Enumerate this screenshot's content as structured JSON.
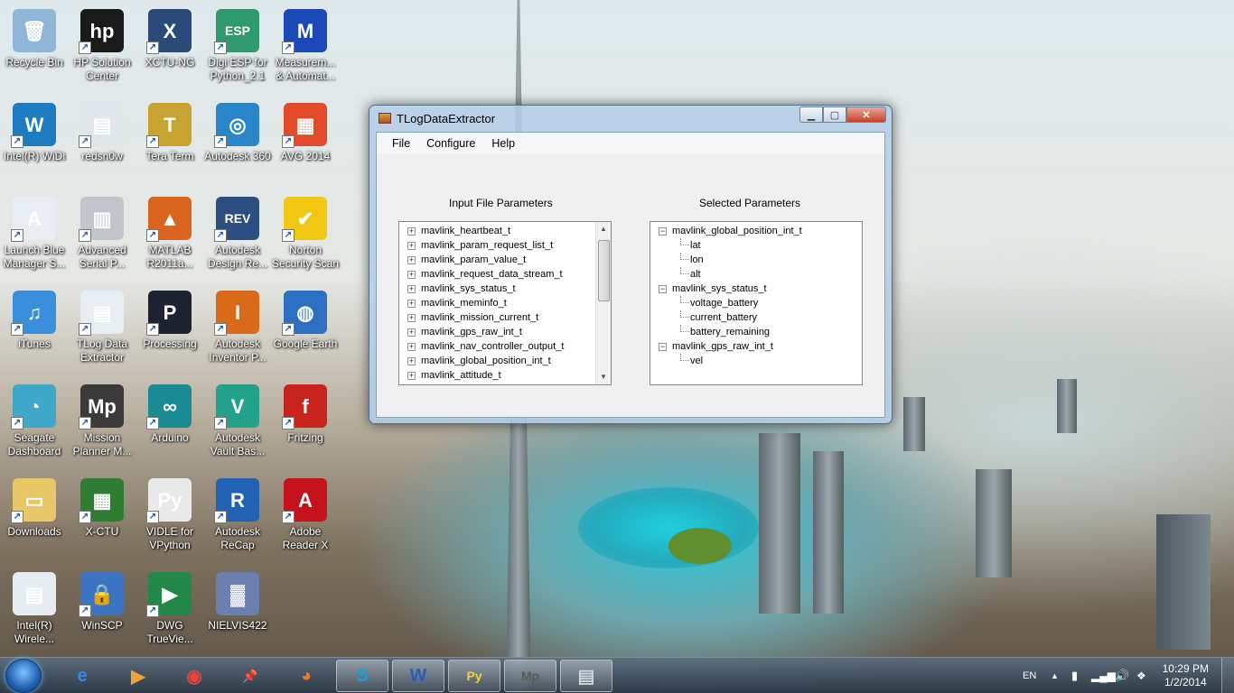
{
  "desktop": {
    "icons": [
      {
        "label": "Recycle Bin",
        "icon": "recycle-bin-icon",
        "color": "#8fb6d6",
        "glyph": "🗑",
        "shortcut": false
      },
      {
        "label": "HP Solution Center",
        "icon": "hp-icon",
        "color": "#1a1a1a",
        "glyph": "hp",
        "shortcut": true
      },
      {
        "label": "XCTU-NG",
        "icon": "xctu-icon",
        "color": "#2a4b7a",
        "glyph": "X",
        "shortcut": true
      },
      {
        "label": "Digi ESP for Python_2.1",
        "icon": "esp-icon",
        "color": "#2e9a6e",
        "glyph": "ESP",
        "shortcut": true
      },
      {
        "label": "Measurem... & Automat...",
        "icon": "measurement-icon",
        "color": "#1b49b8",
        "glyph": "M",
        "shortcut": true
      },
      {
        "label": "Intel(R) WiDi",
        "icon": "widi-icon",
        "color": "#1d7bc1",
        "glyph": "W",
        "shortcut": true
      },
      {
        "label": "redsn0w",
        "icon": "redsn0w-icon",
        "color": "#dfe7ec",
        "glyph": "▤",
        "shortcut": true
      },
      {
        "label": "Tera Term",
        "icon": "teraterm-icon",
        "color": "#c7a431",
        "glyph": "T",
        "shortcut": true
      },
      {
        "label": "Autodesk 360",
        "icon": "autodesk360-icon",
        "color": "#2a86c8",
        "glyph": "◎",
        "shortcut": true
      },
      {
        "label": "AVG 2014",
        "icon": "avg-icon",
        "color": "#e14b2a",
        "glyph": "▦",
        "shortcut": true
      },
      {
        "label": "Launch Blue Manager S...",
        "icon": "bluetooth-icon",
        "color": "#e9eef4",
        "glyph": "A",
        "shortcut": true
      },
      {
        "label": "Advanced Serial P...",
        "icon": "serial-port-icon",
        "color": "#c0c6cc",
        "glyph": "▥",
        "shortcut": true
      },
      {
        "label": "MATLAB R2011a...",
        "icon": "matlab-icon",
        "color": "#d9651f",
        "glyph": "▲",
        "shortcut": true
      },
      {
        "label": "Autodesk Design Re...",
        "icon": "design-review-icon",
        "color": "#2c4f82",
        "glyph": "REV",
        "shortcut": true
      },
      {
        "label": "Norton Security Scan",
        "icon": "norton-icon",
        "color": "#f2c712",
        "glyph": "✔",
        "shortcut": true
      },
      {
        "label": "iTunes",
        "icon": "itunes-icon",
        "color": "#3a8fdc",
        "glyph": "♫",
        "shortcut": true
      },
      {
        "label": "TLog Data Extractor",
        "icon": "tlog-icon",
        "color": "#e7eef3",
        "glyph": "▤",
        "shortcut": true
      },
      {
        "label": "Processing",
        "icon": "processing-icon",
        "color": "#1d2330",
        "glyph": "P",
        "shortcut": true
      },
      {
        "label": "Autodesk Inventor P...",
        "icon": "inventor-icon",
        "color": "#d86a1a",
        "glyph": "I",
        "shortcut": true
      },
      {
        "label": "Google Earth",
        "icon": "google-earth-icon",
        "color": "#2d6fc1",
        "glyph": "◍",
        "shortcut": true
      },
      {
        "label": "Seagate Dashboard",
        "icon": "seagate-icon",
        "color": "#3fa7c8",
        "glyph": "◔",
        "shortcut": true
      },
      {
        "label": "Mission Planner M...",
        "icon": "mission-planner-icon",
        "color": "#3a3a3a",
        "glyph": "Mp",
        "shortcut": true
      },
      {
        "label": "Arduino",
        "icon": "arduino-icon",
        "color": "#1a8a93",
        "glyph": "∞",
        "shortcut": true
      },
      {
        "label": "Autodesk Vault Bas...",
        "icon": "vault-icon",
        "color": "#23a18a",
        "glyph": "V",
        "shortcut": true
      },
      {
        "label": "Fritzing",
        "icon": "fritzing-icon",
        "color": "#c8231c",
        "glyph": "f",
        "shortcut": true
      },
      {
        "label": "Downloads",
        "icon": "folder-icon",
        "color": "#e8c766",
        "glyph": "▭",
        "shortcut": true
      },
      {
        "label": "X-CTU",
        "icon": "x-ctu-icon",
        "color": "#2f7d33",
        "glyph": "▦",
        "shortcut": true
      },
      {
        "label": "VIDLE for VPython",
        "icon": "python-icon",
        "color": "#e9e9e9",
        "glyph": "Py",
        "shortcut": true
      },
      {
        "label": "Autodesk ReCap",
        "icon": "recap-icon",
        "color": "#2163b2",
        "glyph": "R",
        "shortcut": true
      },
      {
        "label": "Adobe Reader X",
        "icon": "adobe-reader-icon",
        "color": "#c5121c",
        "glyph": "A",
        "shortcut": true
      },
      {
        "label": "Intel(R) Wirele...",
        "icon": "intel-wireless-icon",
        "color": "#e6edf2",
        "glyph": "▤",
        "shortcut": false
      },
      {
        "label": "WinSCP",
        "icon": "winscp-icon",
        "color": "#3b74c2",
        "glyph": "🔒",
        "shortcut": true
      },
      {
        "label": "DWG TrueVie...",
        "icon": "dwg-icon",
        "color": "#23874a",
        "glyph": "▶",
        "shortcut": true
      },
      {
        "label": "NIELVIS422",
        "icon": "nielvis-icon",
        "color": "#6b7fb0",
        "glyph": "▓",
        "shortcut": false
      }
    ]
  },
  "window": {
    "title": "TLogDataExtractor",
    "menu": [
      "File",
      "Configure",
      "Help"
    ],
    "input_panel_title": "Input File Parameters",
    "selected_panel_title": "Selected Parameters",
    "input_items": [
      "mavlink_heartbeat_t",
      "mavlink_param_request_list_t",
      "mavlink_param_value_t",
      "mavlink_request_data_stream_t",
      "mavlink_sys_status_t",
      "mavlink_meminfo_t",
      "mavlink_mission_current_t",
      "mavlink_gps_raw_int_t",
      "mavlink_nav_controller_output_t",
      "mavlink_global_position_int_t",
      "mavlink_attitude_t"
    ],
    "selected_tree": [
      {
        "label": "mavlink_global_position_int_t",
        "children": [
          "lat",
          "lon",
          "alt"
        ]
      },
      {
        "label": "mavlink_sys_status_t",
        "children": [
          "voltage_battery",
          "current_battery",
          "battery_remaining"
        ]
      },
      {
        "label": "mavlink_gps_raw_int_t",
        "children": [
          "vel"
        ]
      }
    ]
  },
  "taskbar": {
    "apps": [
      {
        "name": "ie",
        "icon": "internet-explorer-icon",
        "glyph": "e",
        "color": "#2b8be6",
        "running": false
      },
      {
        "name": "media",
        "icon": "media-player-icon",
        "glyph": "▶",
        "color": "#f0a23a",
        "running": false
      },
      {
        "name": "chrome",
        "icon": "chrome-icon",
        "glyph": "◉",
        "color": "#e2453c",
        "running": false
      },
      {
        "name": "pin",
        "icon": "pushpin-icon",
        "glyph": "📌",
        "color": "#e23a2a",
        "running": false
      },
      {
        "name": "firefox",
        "icon": "firefox-icon",
        "glyph": "◕",
        "color": "#f07a1a",
        "running": false
      },
      {
        "name": "skype",
        "icon": "skype-icon",
        "glyph": "S",
        "color": "#16a0e0",
        "running": true
      },
      {
        "name": "word",
        "icon": "word-icon",
        "glyph": "W",
        "color": "#2a5fb8",
        "running": true
      },
      {
        "name": "python",
        "icon": "python-icon",
        "glyph": "Py",
        "color": "#f4d03f",
        "running": true
      },
      {
        "name": "missionplanner",
        "icon": "mission-planner-icon",
        "glyph": "Mp",
        "color": "#5a5a5a",
        "running": true
      },
      {
        "name": "tlog",
        "icon": "tlog-icon",
        "glyph": "▤",
        "color": "#ccd7e0",
        "running": true
      }
    ],
    "language": "EN",
    "time": "10:29 PM",
    "date": "1/2/2014"
  }
}
